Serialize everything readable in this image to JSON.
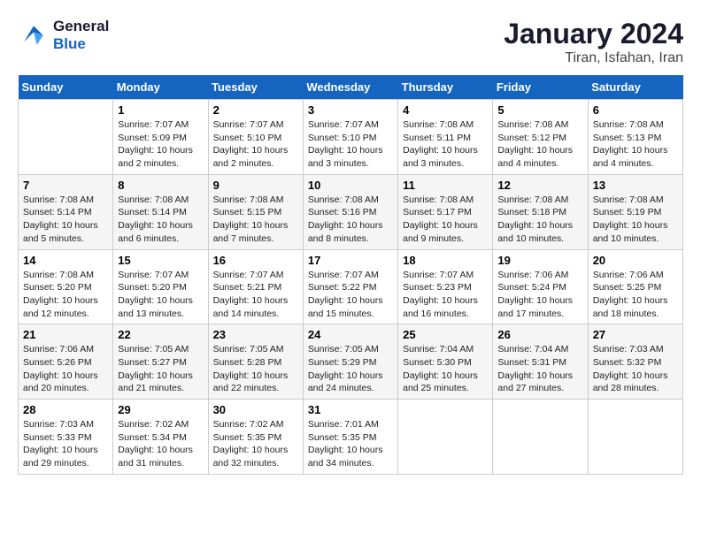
{
  "logo": {
    "line1": "General",
    "line2": "Blue"
  },
  "title": "January 2024",
  "location": "Tiran, Isfahan, Iran",
  "headers": [
    "Sunday",
    "Monday",
    "Tuesday",
    "Wednesday",
    "Thursday",
    "Friday",
    "Saturday"
  ],
  "weeks": [
    [
      {
        "day": "",
        "info": ""
      },
      {
        "day": "1",
        "info": "Sunrise: 7:07 AM\nSunset: 5:09 PM\nDaylight: 10 hours\nand 2 minutes."
      },
      {
        "day": "2",
        "info": "Sunrise: 7:07 AM\nSunset: 5:10 PM\nDaylight: 10 hours\nand 2 minutes."
      },
      {
        "day": "3",
        "info": "Sunrise: 7:07 AM\nSunset: 5:10 PM\nDaylight: 10 hours\nand 3 minutes."
      },
      {
        "day": "4",
        "info": "Sunrise: 7:08 AM\nSunset: 5:11 PM\nDaylight: 10 hours\nand 3 minutes."
      },
      {
        "day": "5",
        "info": "Sunrise: 7:08 AM\nSunset: 5:12 PM\nDaylight: 10 hours\nand 4 minutes."
      },
      {
        "day": "6",
        "info": "Sunrise: 7:08 AM\nSunset: 5:13 PM\nDaylight: 10 hours\nand 4 minutes."
      }
    ],
    [
      {
        "day": "7",
        "info": "Sunrise: 7:08 AM\nSunset: 5:14 PM\nDaylight: 10 hours\nand 5 minutes."
      },
      {
        "day": "8",
        "info": "Sunrise: 7:08 AM\nSunset: 5:14 PM\nDaylight: 10 hours\nand 6 minutes."
      },
      {
        "day": "9",
        "info": "Sunrise: 7:08 AM\nSunset: 5:15 PM\nDaylight: 10 hours\nand 7 minutes."
      },
      {
        "day": "10",
        "info": "Sunrise: 7:08 AM\nSunset: 5:16 PM\nDaylight: 10 hours\nand 8 minutes."
      },
      {
        "day": "11",
        "info": "Sunrise: 7:08 AM\nSunset: 5:17 PM\nDaylight: 10 hours\nand 9 minutes."
      },
      {
        "day": "12",
        "info": "Sunrise: 7:08 AM\nSunset: 5:18 PM\nDaylight: 10 hours\nand 10 minutes."
      },
      {
        "day": "13",
        "info": "Sunrise: 7:08 AM\nSunset: 5:19 PM\nDaylight: 10 hours\nand 10 minutes."
      }
    ],
    [
      {
        "day": "14",
        "info": "Sunrise: 7:08 AM\nSunset: 5:20 PM\nDaylight: 10 hours\nand 12 minutes."
      },
      {
        "day": "15",
        "info": "Sunrise: 7:07 AM\nSunset: 5:20 PM\nDaylight: 10 hours\nand 13 minutes."
      },
      {
        "day": "16",
        "info": "Sunrise: 7:07 AM\nSunset: 5:21 PM\nDaylight: 10 hours\nand 14 minutes."
      },
      {
        "day": "17",
        "info": "Sunrise: 7:07 AM\nSunset: 5:22 PM\nDaylight: 10 hours\nand 15 minutes."
      },
      {
        "day": "18",
        "info": "Sunrise: 7:07 AM\nSunset: 5:23 PM\nDaylight: 10 hours\nand 16 minutes."
      },
      {
        "day": "19",
        "info": "Sunrise: 7:06 AM\nSunset: 5:24 PM\nDaylight: 10 hours\nand 17 minutes."
      },
      {
        "day": "20",
        "info": "Sunrise: 7:06 AM\nSunset: 5:25 PM\nDaylight: 10 hours\nand 18 minutes."
      }
    ],
    [
      {
        "day": "21",
        "info": "Sunrise: 7:06 AM\nSunset: 5:26 PM\nDaylight: 10 hours\nand 20 minutes."
      },
      {
        "day": "22",
        "info": "Sunrise: 7:05 AM\nSunset: 5:27 PM\nDaylight: 10 hours\nand 21 minutes."
      },
      {
        "day": "23",
        "info": "Sunrise: 7:05 AM\nSunset: 5:28 PM\nDaylight: 10 hours\nand 22 minutes."
      },
      {
        "day": "24",
        "info": "Sunrise: 7:05 AM\nSunset: 5:29 PM\nDaylight: 10 hours\nand 24 minutes."
      },
      {
        "day": "25",
        "info": "Sunrise: 7:04 AM\nSunset: 5:30 PM\nDaylight: 10 hours\nand 25 minutes."
      },
      {
        "day": "26",
        "info": "Sunrise: 7:04 AM\nSunset: 5:31 PM\nDaylight: 10 hours\nand 27 minutes."
      },
      {
        "day": "27",
        "info": "Sunrise: 7:03 AM\nSunset: 5:32 PM\nDaylight: 10 hours\nand 28 minutes."
      }
    ],
    [
      {
        "day": "28",
        "info": "Sunrise: 7:03 AM\nSunset: 5:33 PM\nDaylight: 10 hours\nand 29 minutes."
      },
      {
        "day": "29",
        "info": "Sunrise: 7:02 AM\nSunset: 5:34 PM\nDaylight: 10 hours\nand 31 minutes."
      },
      {
        "day": "30",
        "info": "Sunrise: 7:02 AM\nSunset: 5:35 PM\nDaylight: 10 hours\nand 32 minutes."
      },
      {
        "day": "31",
        "info": "Sunrise: 7:01 AM\nSunset: 5:35 PM\nDaylight: 10 hours\nand 34 minutes."
      },
      {
        "day": "",
        "info": ""
      },
      {
        "day": "",
        "info": ""
      },
      {
        "day": "",
        "info": ""
      }
    ]
  ]
}
